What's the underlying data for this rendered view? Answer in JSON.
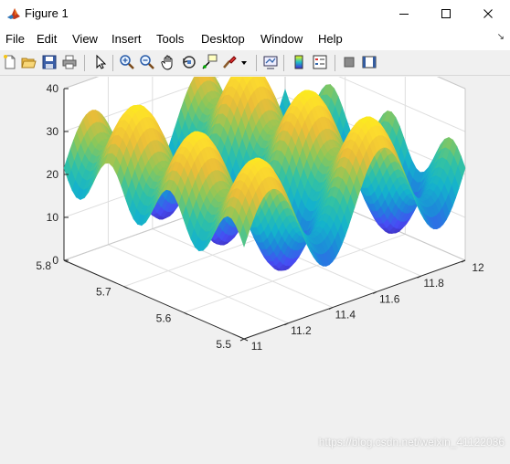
{
  "window": {
    "title": "Figure 1",
    "controls": {
      "minimize": "—",
      "maximize": "☐",
      "close": "✕"
    }
  },
  "menu": {
    "items": [
      "File",
      "Edit",
      "View",
      "Insert",
      "Tools",
      "Desktop",
      "Window",
      "Help"
    ],
    "overflow_glyph": "↘"
  },
  "toolbar": {
    "buttons": [
      {
        "name": "new-figure-icon"
      },
      {
        "name": "open-file-icon"
      },
      {
        "name": "save-icon"
      },
      {
        "name": "print-icon"
      },
      {
        "name": "edit-plot-arrow-icon"
      },
      {
        "name": "zoom-in-icon"
      },
      {
        "name": "zoom-out-icon"
      },
      {
        "name": "pan-hand-icon"
      },
      {
        "name": "rotate-3d-icon"
      },
      {
        "name": "data-cursor-icon"
      },
      {
        "name": "brush-icon"
      },
      {
        "name": "brush-dropdown-icon"
      },
      {
        "name": "link-plot-icon"
      },
      {
        "name": "insert-colorbar-icon"
      },
      {
        "name": "insert-legend-icon"
      },
      {
        "name": "hide-plot-tools-icon"
      },
      {
        "name": "show-plot-tools-icon"
      }
    ]
  },
  "colors": {
    "low": "#3e2bd6",
    "mid": "#1fc0c8",
    "high": "#f8fa0d",
    "orange": "#f7a832",
    "accent": "#0072bd"
  },
  "chart_data": {
    "type": "surface",
    "title": "",
    "xlabel": "",
    "ylabel": "",
    "zlabel": "",
    "x_ticks": [
      "11",
      "11.2",
      "11.4",
      "11.6",
      "11.8",
      "12"
    ],
    "y_ticks": [
      "5.5",
      "5.6",
      "5.7",
      "5.8"
    ],
    "z_ticks": [
      "0",
      "10",
      "20",
      "30",
      "40"
    ],
    "xlim": [
      11,
      12
    ],
    "ylim": [
      5.5,
      5.8
    ],
    "zlim": [
      0,
      40
    ],
    "grid": true,
    "colormap": "parula"
  },
  "watermark": "https://blog.csdn.net/weixin_41122036"
}
